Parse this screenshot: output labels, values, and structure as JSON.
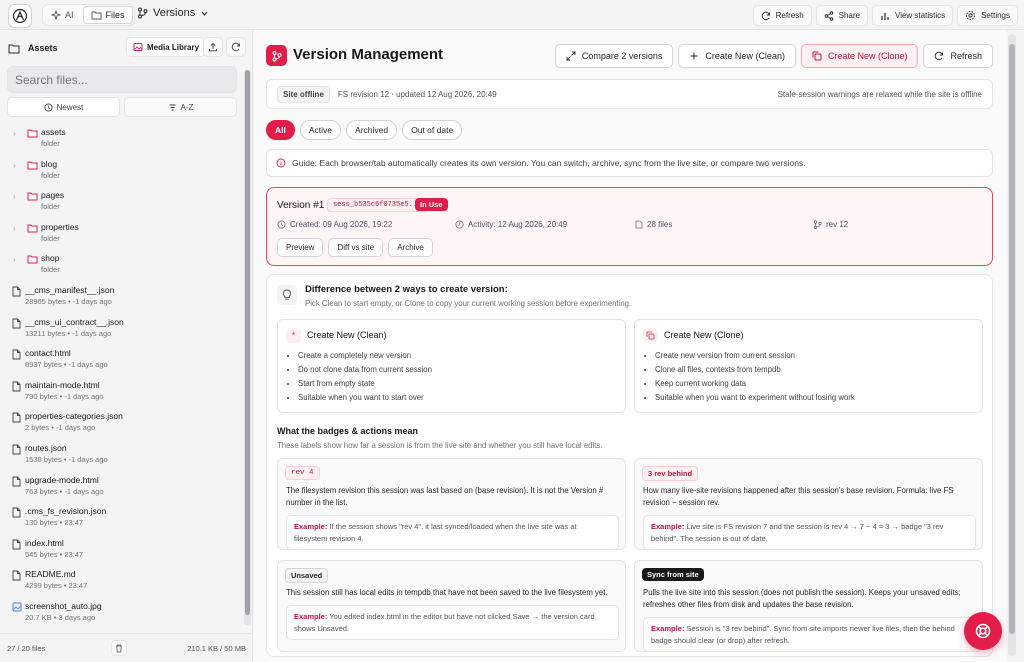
{
  "topbar": {
    "mode_tabs": [
      {
        "label": "AI"
      },
      {
        "label": "Files"
      }
    ],
    "versions_label": "Versions",
    "buttons": [
      {
        "label": "Refresh"
      },
      {
        "label": "Share"
      },
      {
        "label": "View statistics"
      },
      {
        "label": "Settings"
      }
    ]
  },
  "sidebar": {
    "title": "Assets",
    "media_library": "Media Library",
    "search_placeholder": "Search files...",
    "sort": [
      {
        "label": "Newest"
      },
      {
        "label": "A-Z"
      }
    ],
    "items": [
      {
        "name": "assets",
        "meta": "folder",
        "type": "folder"
      },
      {
        "name": "blog",
        "meta": "folder",
        "type": "folder"
      },
      {
        "name": "pages",
        "meta": "folder",
        "type": "folder"
      },
      {
        "name": "properties",
        "meta": "folder",
        "type": "folder"
      },
      {
        "name": "shop",
        "meta": "folder",
        "type": "folder"
      },
      {
        "name": "__cms_manifest__.json",
        "meta": "28965 bytes • -1 days ago",
        "type": "file"
      },
      {
        "name": "__cms_ui_contract__.json",
        "meta": "13211 bytes • -1 days ago",
        "type": "file"
      },
      {
        "name": "contact.html",
        "meta": "8937 bytes • -1 days ago",
        "type": "file"
      },
      {
        "name": "maintain-mode.html",
        "meta": "790 bytes • -1 days ago",
        "type": "file"
      },
      {
        "name": "properties-categories.json",
        "meta": "2 bytes • -1 days ago",
        "type": "file"
      },
      {
        "name": "routes.json",
        "meta": "1538 bytes • -1 days ago",
        "type": "file"
      },
      {
        "name": "upgrade-mode.html",
        "meta": "763 bytes • -1 days ago",
        "type": "file"
      },
      {
        "name": ".cms_fs_revision.json",
        "meta": "130 bytes • 23:47",
        "type": "file"
      },
      {
        "name": "index.html",
        "meta": "545 bytes • 23:47",
        "type": "file"
      },
      {
        "name": "README.md",
        "meta": "4299 bytes • 23:47",
        "type": "file"
      },
      {
        "name": "screenshot_auto.jpg",
        "meta": "20.7 KB • 3 days ago",
        "type": "image"
      }
    ],
    "footer_count": "27 / 20 files",
    "footer_usage": "210.1 KB / 50 MB"
  },
  "main": {
    "title": "Version Management",
    "header_buttons": {
      "compare": "Compare 2 versions",
      "new_clean": "Create New (Clean)",
      "new_clone": "Create New (Clone)",
      "refresh": "Refresh"
    },
    "status": {
      "badge": "Site offline",
      "revision": "FS revision 12 · updated 12 Aug 2026, 20:49",
      "note": "Stale-session warnings are relaxed while the site is offline"
    },
    "filters": [
      {
        "label": "All"
      },
      {
        "label": "Active"
      },
      {
        "label": "Archived"
      },
      {
        "label": "Out of date"
      }
    ],
    "guide": "Guide: Each browser/tab automatically creates its own version. You can switch, archive, sync from the live site, or compare two versions.",
    "version_card": {
      "title": "Version #1",
      "session": "sess_b535c6f0735e5...",
      "status": "In Use",
      "created": "Created: 09 Aug 2026, 19:22",
      "activity": "Activity: 12 Aug 2026, 20:49",
      "files": "28 files",
      "rev": "rev 12",
      "actions": [
        {
          "label": "Preview"
        },
        {
          "label": "Diff vs site"
        },
        {
          "label": "Archive"
        }
      ]
    },
    "info": {
      "title": "Difference between 2 ways to create version:",
      "subtitle": "Pick Clean to start empty, or Clone to copy your current working session before experimenting.",
      "clean": {
        "title": "Create New (Clean)",
        "points": [
          "Create a completely new version",
          "Do not clone data from current session",
          "Start from empty state",
          "Suitable when you want to start over"
        ]
      },
      "clone": {
        "title": "Create New (Clone)",
        "points": [
          "Create new version from current session",
          "Clone all files, contexts from tempdb",
          "Keep current working data",
          "Suitable when you want to experiment without losing work"
        ]
      },
      "badges_title": "What the badges & actions mean",
      "badges_subtitle": "These labels show how far a session is from the live site and whether you still have local edits.",
      "badges": [
        {
          "badge": "rev 4",
          "desc": "The filesystem revision this session was last based on (base revision). It is not the Version # number in the list.",
          "example_label": "Example:",
          "example": "If the session shows \"rev 4\", it last synced/loaded when the live site was at filesystem revision 4."
        },
        {
          "badge": "3 rev behind",
          "desc": "How many live-site revisions happened after this session's base revision. Formula: live FS revision − session rev.",
          "example_label": "Example:",
          "example": "Live site is FS revision 7 and the session is rev 4 → 7 − 4 = 3 → badge \"3 rev behind\". The session is out of date."
        },
        {
          "badge": "Unsaved",
          "desc": "This session still has local edits in tempdb that have not been saved to the live filesystem yet.",
          "example_label": "Example:",
          "example": "You edited index.html in the editor but have not clicked Save → the version card shows Unsaved."
        },
        {
          "badge": "Sync from site",
          "desc": "Pulls the live site into this session (does not publish the session). Keeps your unsaved edits; refreshes other files from disk and updates the base revision.",
          "example_label": "Example:",
          "example": "Session is \"3 rev behind\". Sync from site imports newer live files, then the behind badge should clear (or drop) after refresh."
        }
      ]
    }
  },
  "colors": {
    "accent": "#e11d48",
    "accent_soft": "#fff1f2"
  }
}
